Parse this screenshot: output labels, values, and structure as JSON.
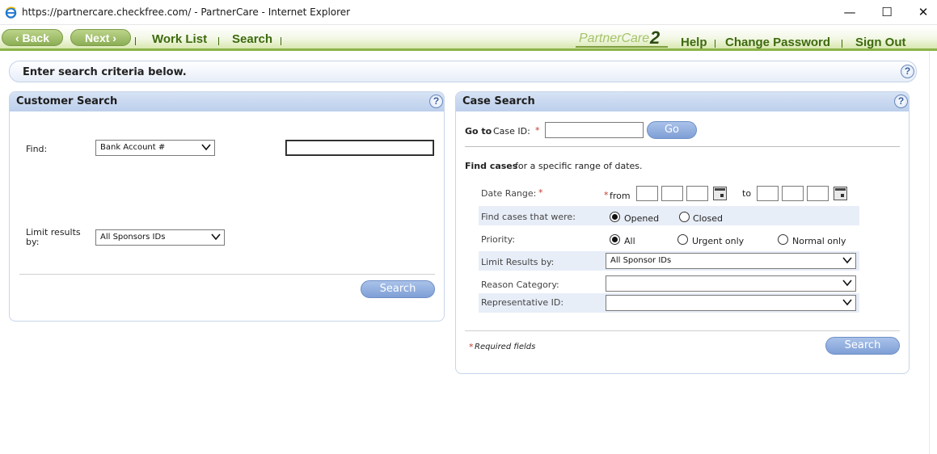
{
  "window": {
    "title": "https://partnercare.checkfree.com/ - PartnerCare - Internet Explorer",
    "minimize": "—",
    "maximize": "☐",
    "close": "✕"
  },
  "nav": {
    "back": "‹ Back",
    "next": "Next ›",
    "work_list": "Work List",
    "search": "Search",
    "brand": "PartnerCare",
    "brand_version": "2",
    "help": "Help",
    "change_password": "Change Password",
    "sign_out": "Sign Out"
  },
  "info": {
    "text": "Enter search criteria below.",
    "help": "?"
  },
  "customer_search": {
    "title": "Customer Search",
    "help": "?",
    "find_label": "Find:",
    "find_select": "Bank Account #",
    "find_value": "",
    "limit_label": "Limit results by:",
    "limit_select": "All Sponsors IDs",
    "search_button": "Search"
  },
  "case_search": {
    "title": "Case Search",
    "help": "?",
    "goto_prefix": "Go to",
    "goto_label": "Case ID:",
    "required_mark": "*",
    "case_id_value": "",
    "go_button": "Go",
    "find_cases_bold": "Find cases",
    "find_cases_rest": "for a specific range of dates.",
    "date_range_label": "Date Range:",
    "from_label": "from",
    "to_label": "to",
    "were_label": "Find cases that were:",
    "opened": "Opened",
    "closed": "Closed",
    "priority_label": "Priority:",
    "priority_all": "All",
    "priority_urgent": "Urgent only",
    "priority_normal": "Normal only",
    "limit_label": "Limit Results by:",
    "limit_select": "All Sponsor IDs",
    "reason_label": "Reason Category:",
    "reason_select": "",
    "rep_label": "Representative ID:",
    "rep_select": "",
    "required_note": "Required fields",
    "search_button": "Search"
  }
}
